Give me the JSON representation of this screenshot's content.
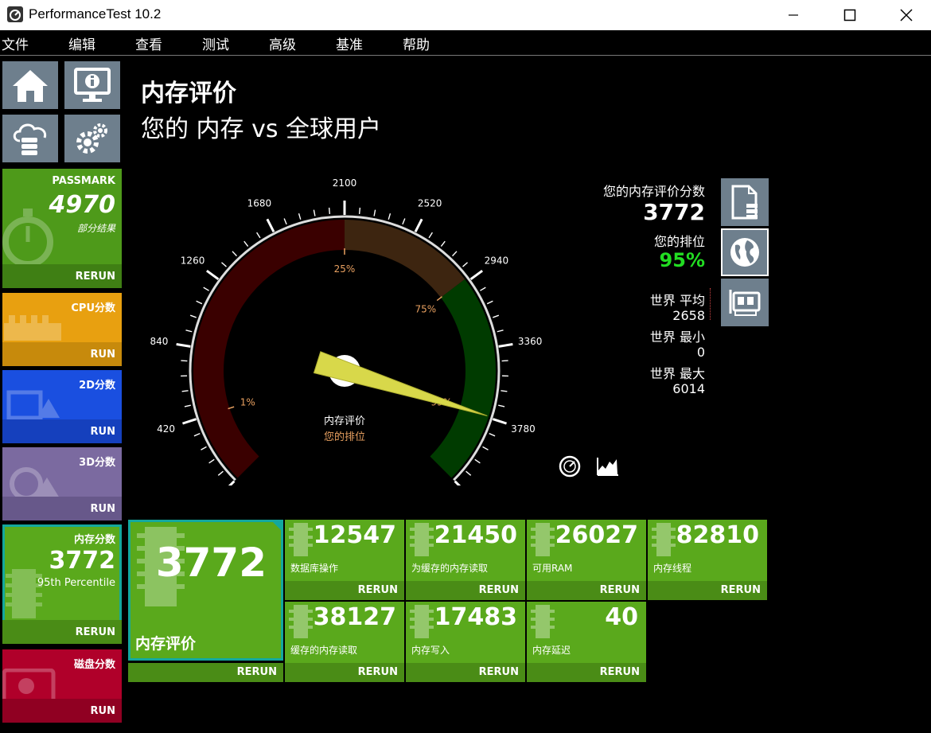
{
  "window": {
    "title": "PerformanceTest 10.2"
  },
  "menu": [
    "文件",
    "编辑",
    "查看",
    "测试",
    "高级",
    "基准",
    "帮助"
  ],
  "sidebar": {
    "passmark": {
      "title": "PASSMARK",
      "score": "4970",
      "subtitle": "部分结果",
      "action": "RERUN"
    },
    "cpu": {
      "title": "CPU分数",
      "action": "RUN"
    },
    "2d": {
      "title": "2D分数",
      "action": "RUN"
    },
    "3d": {
      "title": "3D分数",
      "action": "RUN"
    },
    "memory": {
      "title": "内存分数",
      "score": "3772",
      "subtitle": "95th Percentile",
      "action": "RERUN"
    },
    "disk": {
      "title": "磁盘分数",
      "action": "RUN"
    }
  },
  "header": {
    "title": "内存评价",
    "subtitle": "您的 内存 vs 全球用户"
  },
  "gauge": {
    "min": 0,
    "max": 4200,
    "value": 3772,
    "ticks": [
      "0",
      "420",
      "840",
      "1260",
      "1680",
      "2100",
      "2520",
      "2940",
      "3360",
      "3780",
      "4200"
    ],
    "tick_values": [
      0,
      420,
      840,
      1260,
      1680,
      2100,
      2520,
      2940,
      3360,
      3780,
      4200
    ],
    "percentile_marks": [
      {
        "label": "1%",
        "value": 420
      },
      {
        "label": "25%",
        "value": 2100
      },
      {
        "label": "75%",
        "value": 2920
      },
      {
        "label": "99%",
        "value": 3780
      }
    ],
    "center_label": "内存评价",
    "center_sublabel": "您的排位"
  },
  "stats": {
    "score_label": "您的内存评价分数",
    "score": "3772",
    "rank_label": "您的排位",
    "rank": "95%",
    "world_avg_label": "世界 平均",
    "world_avg": "2658",
    "world_min_label": "世界 最小",
    "world_min": "0",
    "world_max_label": "世界 最大",
    "world_max": "6014"
  },
  "main_tile": {
    "score": "3772",
    "label": "内存评价",
    "action": "RERUN"
  },
  "subtests": [
    {
      "value": "12547",
      "label": "数据库操作",
      "action": "RERUN"
    },
    {
      "value": "21450",
      "label": "为缓存的内存读取",
      "action": "RERUN"
    },
    {
      "value": "26027",
      "label": "可用RAM",
      "action": "RERUN"
    },
    {
      "value": "82810",
      "label": "内存线程",
      "action": "RERUN"
    },
    {
      "value": "38127",
      "label": "缓存的内存读取",
      "action": "RERUN"
    },
    {
      "value": "17483",
      "label": "内存写入",
      "action": "RERUN"
    },
    {
      "value": "40",
      "label": "内存延迟",
      "action": "RERUN"
    }
  ],
  "colors": {
    "accent_green": "#5aa91c",
    "rank_green": "#22dd22",
    "passmark_tile": "#4e9a1a",
    "cpu_tile": "#e8a010",
    "2d_tile": "#1a4fe0",
    "3d_tile": "#7b6aa0",
    "disk_tile": "#b0002a",
    "gauge_red": "#3a0000",
    "gauge_brown": "#3d2510",
    "gauge_green": "#003b00",
    "needle": "#d8d84a"
  }
}
